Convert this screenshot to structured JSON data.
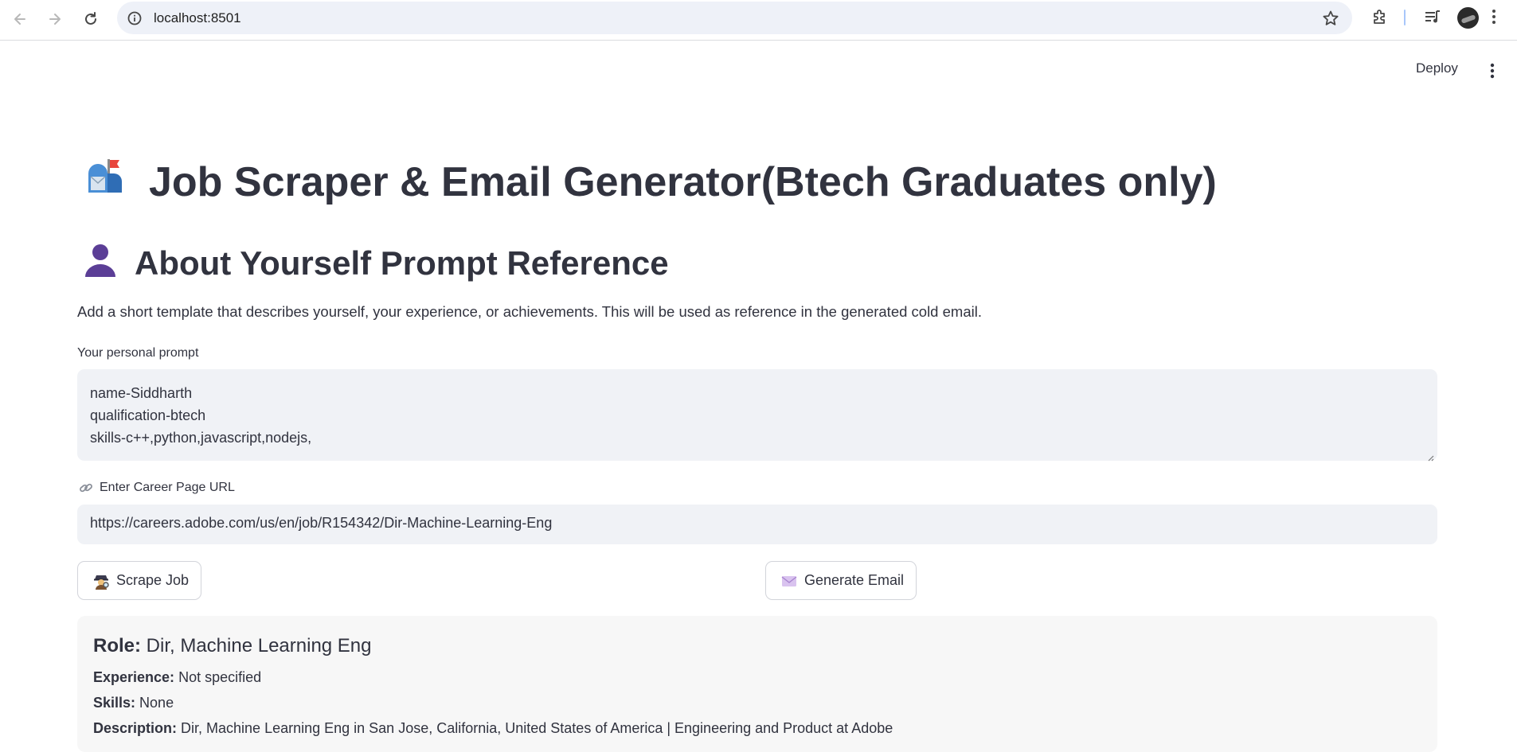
{
  "browser": {
    "url": "localhost:8501",
    "icons": [
      "back-arrow-icon",
      "forward-arrow-icon",
      "reload-icon",
      "site-info-icon",
      "bookmark-star-icon",
      "extensions-icon",
      "media-control-icon",
      "profile-avatar",
      "browser-menu-icon"
    ]
  },
  "app_header": {
    "deploy_label": "Deploy"
  },
  "page": {
    "title": "Job Scraper & Email Generator(Btech Graduates only)",
    "subtitle": "About Yourself Prompt Reference",
    "description": "Add a short template that describes yourself, your experience, or achievements. This will be used as reference in the generated cold email."
  },
  "form": {
    "prompt_label": "Your personal prompt",
    "prompt_value": "name-Siddharth\nqualification-btech\nskills-c++,python,javascript,nodejs,",
    "url_label": "Enter Career Page URL",
    "url_value": "https://careers.adobe.com/us/en/job/R154342/Dir-Machine-Learning-Eng",
    "scrape_button": "Scrape Job",
    "generate_button": "Generate Email"
  },
  "result": {
    "role_key": "Role:",
    "role_value": "Dir, Machine Learning Eng",
    "experience_key": "Experience:",
    "experience_value": "Not specified",
    "skills_key": "Skills:",
    "skills_value": "None",
    "description_key": "Description:",
    "description_value": "Dir, Machine Learning Eng in San Jose, California, United States of America | Engineering and Product at Adobe"
  },
  "colors": {
    "text": "#31333f",
    "input_bg": "#f0f2f6",
    "result_bg": "#f7f7f7",
    "omnibox_bg": "#eef1f8"
  }
}
